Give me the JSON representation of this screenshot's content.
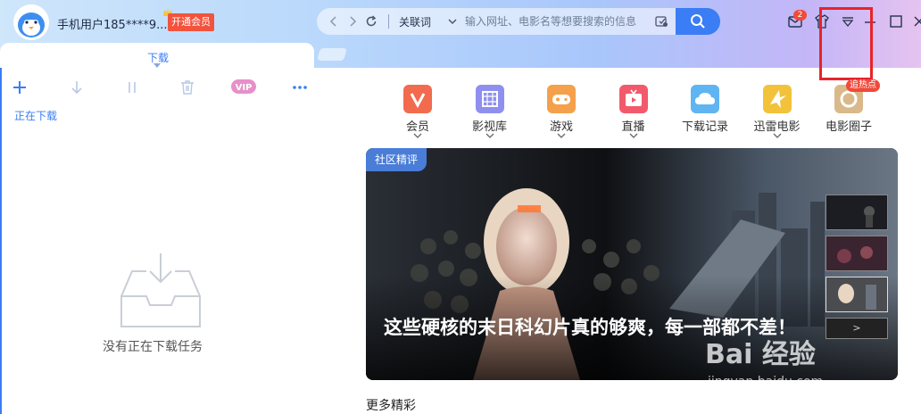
{
  "user": {
    "name": "手机用户185****9...",
    "vip_button": "开通会员"
  },
  "address_bar": {
    "mode_label": "关联词",
    "placeholder": "输入网址、电影名等想要搜索的信息"
  },
  "toolbar": {
    "message_badge": "2"
  },
  "tabs": {
    "active_label": "下载"
  },
  "download_panel": {
    "tools": [
      "add",
      "download",
      "pause",
      "delete",
      "vip",
      "more"
    ],
    "vip_label": "VIP",
    "more_label": "•••",
    "section_label": "正在下载",
    "empty_text": "没有正在下载任务"
  },
  "categories": [
    {
      "label": "会员",
      "icon": "vip-v-icon",
      "color": "#f26b4e",
      "has_dropdown": true
    },
    {
      "label": "影视库",
      "icon": "film-icon",
      "color": "#8f8ff0",
      "has_dropdown": true
    },
    {
      "label": "游戏",
      "icon": "gamepad-icon",
      "color": "#f5a04a",
      "has_dropdown": true
    },
    {
      "label": "直播",
      "icon": "tv-icon",
      "color": "#f25a6c",
      "has_dropdown": true
    },
    {
      "label": "下载记录",
      "icon": "cloud-icon",
      "color": "#5fb4f2",
      "has_dropdown": false
    },
    {
      "label": "迅雷电影",
      "icon": "bird-icon",
      "color": "#f2c23a",
      "has_dropdown": true
    },
    {
      "label": "电影圈子",
      "icon": "circle-icon",
      "color": "#d9b98a",
      "has_dropdown": false
    }
  ],
  "category_badge": "追热点",
  "banner": {
    "tag": "社区精评",
    "title": "这些硬核的末日科幻片真的够爽，每一部都不差！",
    "more_label": ">"
  },
  "more_title": "更多精彩",
  "watermark": {
    "logo": "Bai 经验",
    "url": "jingyan.baidu.com"
  }
}
